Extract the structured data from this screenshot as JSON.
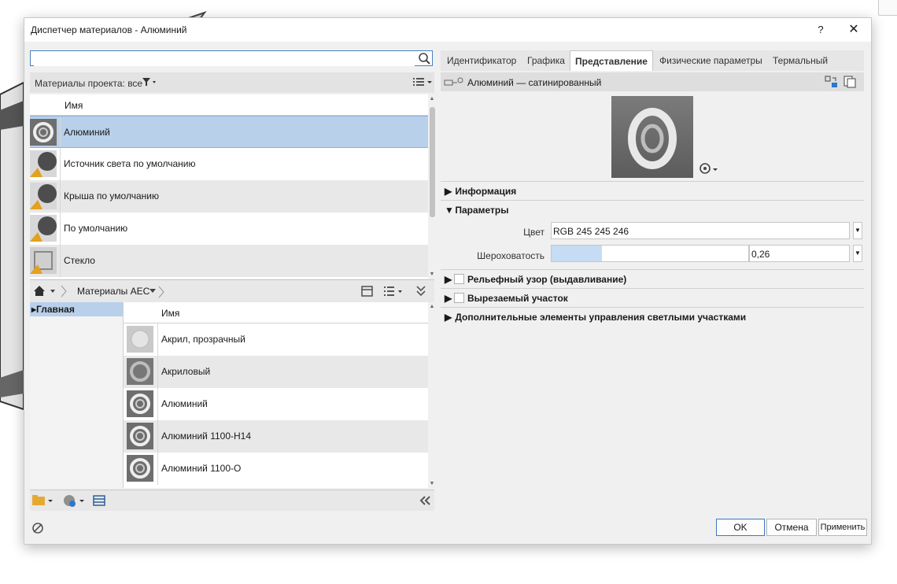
{
  "window": {
    "title": "Диспетчер материалов - Алюминий",
    "help": "?",
    "close": "✕"
  },
  "left": {
    "search_value": "",
    "project_label": "Материалы проекта: все",
    "list_header": "Имя",
    "materials": [
      {
        "name": "Алюминий",
        "selected": true,
        "icon": "metal-ring"
      },
      {
        "name": "Источник света по умолчанию",
        "icon": "sphere-gray"
      },
      {
        "name": "Крыша по умолчанию",
        "icon": "sphere-gray"
      },
      {
        "name": "По умолчанию",
        "icon": "sphere-gray"
      },
      {
        "name": "Стекло",
        "icon": "glass"
      }
    ],
    "library_breadcrumb": "Материалы AEC",
    "tree_root": "▸Главная",
    "library_header": "Имя",
    "library_items": [
      {
        "name": "Акрил, прозрачный"
      },
      {
        "name": "Акриловый"
      },
      {
        "name": "Алюминий"
      },
      {
        "name": "Алюминий 1100-H14"
      },
      {
        "name": "Алюминий 1100-O"
      }
    ]
  },
  "right": {
    "tabs": [
      "Идентификатор",
      "Графика",
      "Представление",
      "Физические параметры",
      "Термальный"
    ],
    "active_tab": "Представление",
    "asset_name": "Алюминий — сатинированный",
    "sections": {
      "info": "Информация",
      "params": "Параметры",
      "relief": "Рельефный узор (выдавливание)",
      "cutout": "Вырезаемый участок",
      "advanced": "Дополнительные элементы управления светлыми участками"
    },
    "color_label": "Цвет",
    "color_value": "RGB 245 245 246",
    "roughness_label": "Шероховатость",
    "roughness_value": "0,26"
  },
  "footer": {
    "ok": "OK",
    "cancel": "Отмена",
    "apply": "Применить"
  },
  "colors": {
    "selection": "#b9d0ea",
    "accent": "#3b78c4"
  }
}
